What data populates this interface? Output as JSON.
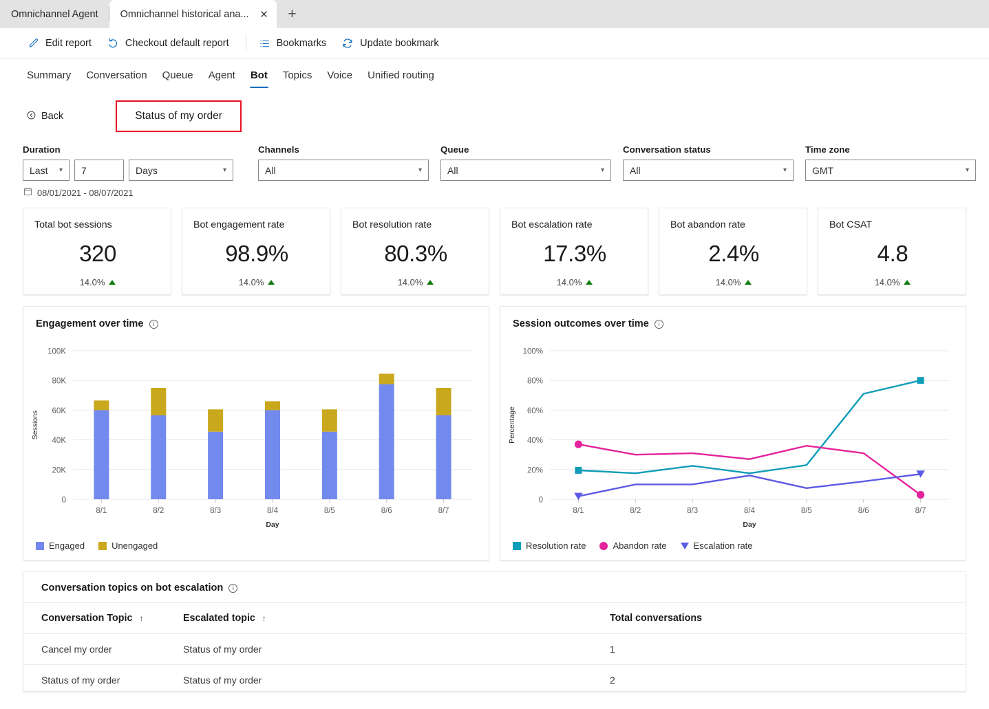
{
  "browser": {
    "tabs": [
      {
        "title": "Omnichannel Agent",
        "active": false
      },
      {
        "title": "Omnichannel historical ana...",
        "active": true
      }
    ],
    "close_icon": "✕",
    "new_tab_icon": "+"
  },
  "commandbar": {
    "items": [
      {
        "label": "Edit report",
        "icon": "pencil-icon"
      },
      {
        "label": "Checkout default report",
        "icon": "undo-icon"
      },
      {
        "label": "Bookmarks",
        "icon": "list-icon"
      },
      {
        "label": "Update bookmark",
        "icon": "refresh-icon"
      }
    ]
  },
  "nav": {
    "tabs": [
      {
        "label": "Summary",
        "selected": false
      },
      {
        "label": "Conversation",
        "selected": false
      },
      {
        "label": "Queue",
        "selected": false
      },
      {
        "label": "Agent",
        "selected": false
      },
      {
        "label": "Bot",
        "selected": true
      },
      {
        "label": "Topics",
        "selected": false
      },
      {
        "label": "Voice",
        "selected": false
      },
      {
        "label": "Unified routing",
        "selected": false
      }
    ]
  },
  "drill": {
    "back_label": "Back",
    "title": "Status of my order",
    "highlight_color": "#e81123"
  },
  "filters": {
    "duration": {
      "label": "Duration",
      "relative": "Last",
      "amount": "7",
      "unit": "Days"
    },
    "channels": {
      "label": "Channels",
      "value": "All"
    },
    "queue": {
      "label": "Queue",
      "value": "All"
    },
    "conversation_status": {
      "label": "Conversation status",
      "value": "All"
    },
    "time_zone": {
      "label": "Time zone",
      "value": "GMT"
    },
    "date_range": "08/01/2021 - 08/07/2021"
  },
  "kpis": [
    {
      "title": "Total bot sessions",
      "value": "320",
      "delta": "14.0%",
      "trend": "up"
    },
    {
      "title": "Bot engagement rate",
      "value": "98.9%",
      "delta": "14.0%",
      "trend": "up"
    },
    {
      "title": "Bot resolution rate",
      "value": "80.3%",
      "delta": "14.0%",
      "trend": "up"
    },
    {
      "title": "Bot escalation rate",
      "value": "17.3%",
      "delta": "14.0%",
      "trend": "up"
    },
    {
      "title": "Bot abandon rate",
      "value": "2.4%",
      "delta": "14.0%",
      "trend": "up"
    },
    {
      "title": "Bot CSAT",
      "value": "4.8",
      "delta": "14.0%",
      "trend": "up"
    }
  ],
  "panels": {
    "engagement_title": "Engagement over time",
    "outcomes_title": "Session outcomes over time",
    "topics_title": "Conversation topics on bot escalation"
  },
  "chart_data": [
    {
      "type": "bar",
      "stacked": true,
      "title": "Engagement over time",
      "xlabel": "Day",
      "ylabel": "Sessions",
      "categories": [
        "8/1",
        "8/2",
        "8/3",
        "8/4",
        "8/5",
        "8/6",
        "8/7"
      ],
      "ylim": [
        0,
        100000
      ],
      "yticks": [
        0,
        20000,
        40000,
        60000,
        80000,
        100000
      ],
      "ytick_labels": [
        "0",
        "20K",
        "40K",
        "60K",
        "80K",
        "100K"
      ],
      "grid": true,
      "legend_position": "bottom-left",
      "series": [
        {
          "name": "Engaged",
          "color": "#7289ee",
          "values": [
            60000,
            56500,
            45500,
            60000,
            45500,
            77500,
            56500
          ]
        },
        {
          "name": "Unengaged",
          "color": "#c9a81e",
          "values": [
            6500,
            18500,
            15000,
            6000,
            15000,
            7000,
            18500
          ]
        }
      ]
    },
    {
      "type": "line",
      "title": "Session outcomes over time",
      "xlabel": "Day",
      "ylabel": "Percentage",
      "categories": [
        "8/1",
        "8/2",
        "8/3",
        "8/4",
        "8/5",
        "8/6",
        "8/7"
      ],
      "ylim": [
        0,
        100
      ],
      "yticks": [
        0,
        20,
        40,
        60,
        80,
        100
      ],
      "ytick_labels": [
        "0",
        "20%",
        "40%",
        "60%",
        "80%",
        "100%"
      ],
      "grid": true,
      "legend_position": "bottom-left",
      "series": [
        {
          "name": "Resolution rate",
          "color": "#0e9db8",
          "marker": "square",
          "values": [
            19.5,
            17.5,
            22.5,
            17.5,
            23,
            71,
            80
          ]
        },
        {
          "name": "Abandon rate",
          "color": "#e5239d",
          "marker": "circle",
          "values": [
            37,
            30,
            31,
            27,
            36,
            31,
            3
          ]
        },
        {
          "name": "Escalation rate",
          "color": "#5b5be6",
          "marker": "triangle-down",
          "values": [
            2,
            10,
            10,
            16,
            7.5,
            12,
            17
          ]
        }
      ]
    }
  ],
  "topics_table": {
    "columns": [
      "Conversation Topic",
      "Escalated topic",
      "Total conversations"
    ],
    "sort_icon": "↑",
    "rows": [
      {
        "topic": "Cancel my order",
        "escalated": "Status of my order",
        "total": "1"
      },
      {
        "topic": "Status of my order",
        "escalated": "Status of my order",
        "total": "2"
      }
    ]
  }
}
